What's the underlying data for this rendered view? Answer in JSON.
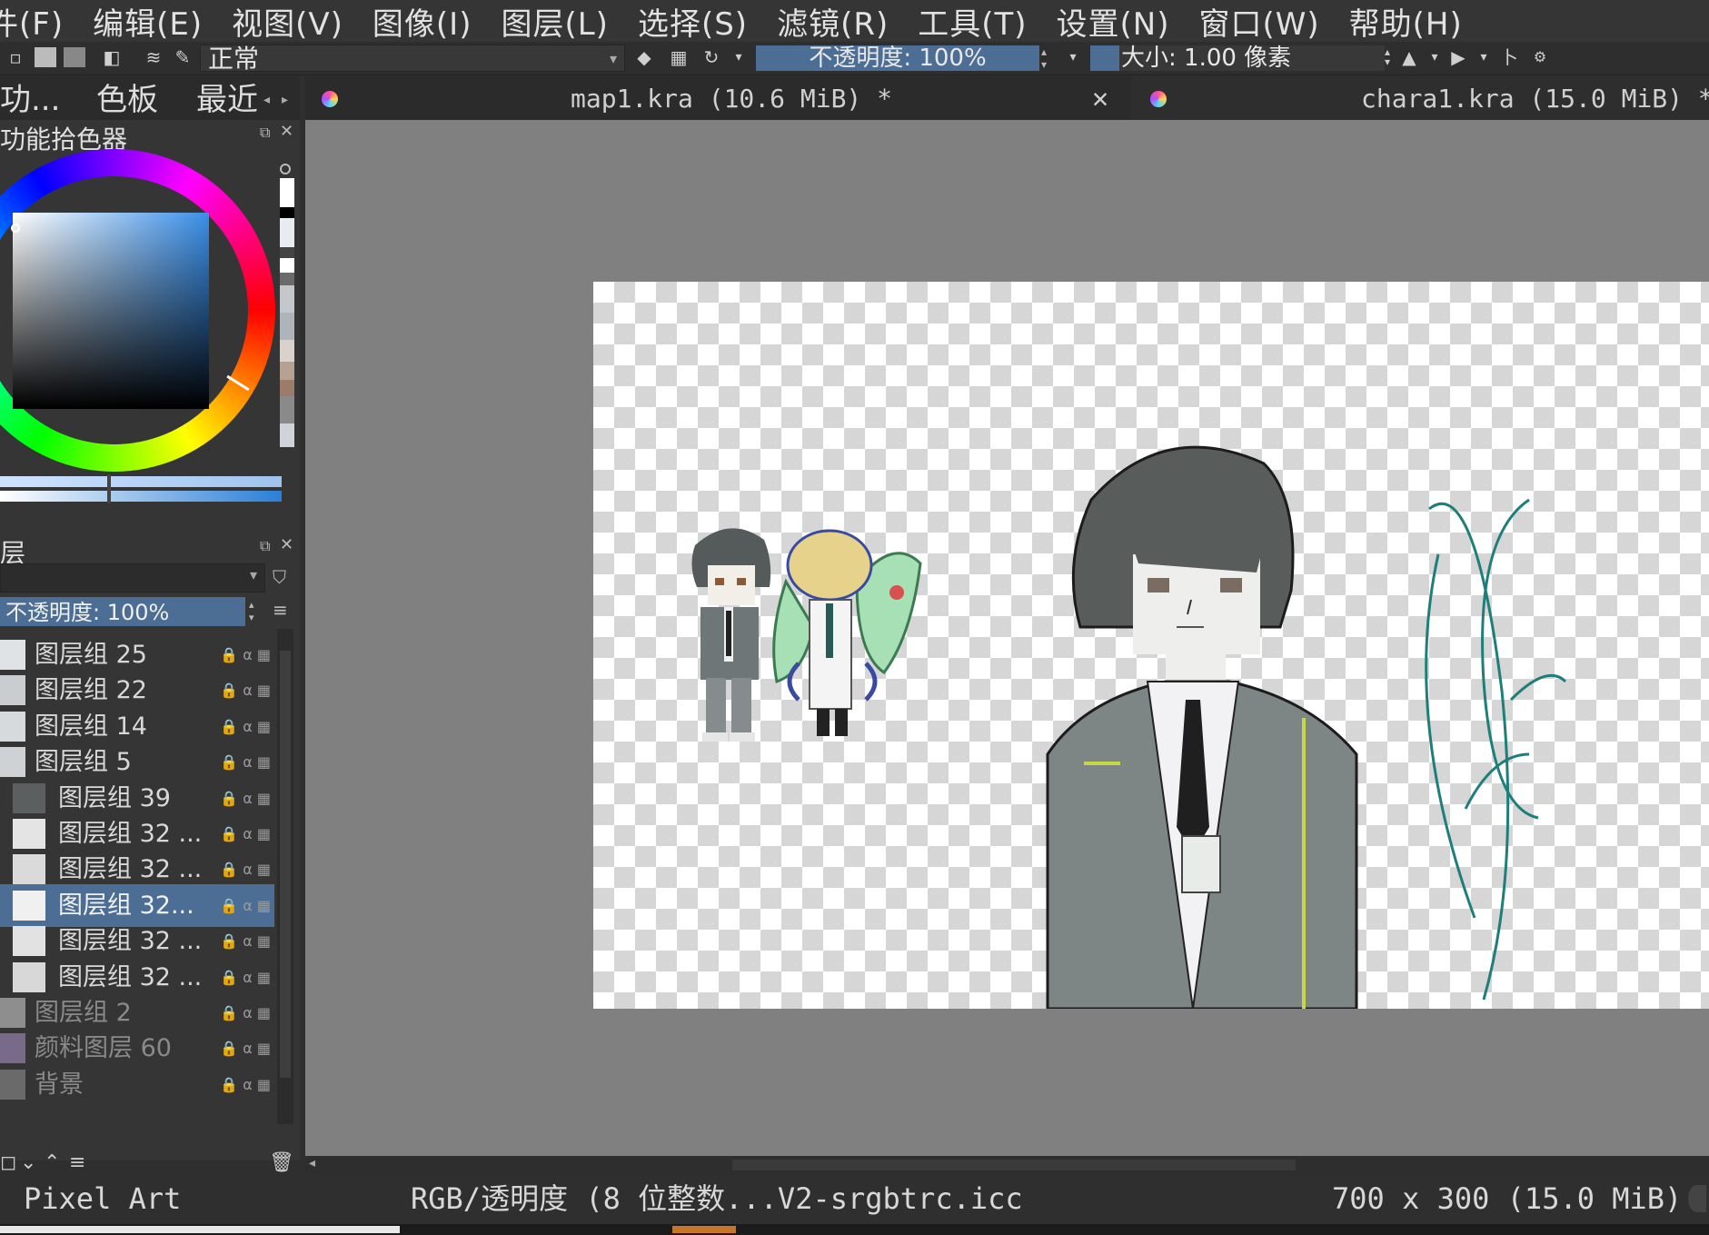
{
  "menu": [
    "件(F)",
    "编辑(E)",
    "视图(V)",
    "图像(I)",
    "图层(L)",
    "选择(S)",
    "滤镜(R)",
    "工具(T)",
    "设置(N)",
    "窗口(W)",
    "帮助(H)"
  ],
  "toolbar": {
    "blend_mode": "正常",
    "opacity_label": "不透明度:  100%",
    "size_label": "大小:  1.00 像素"
  },
  "dock_tabs": [
    "功...",
    "色板",
    "最近"
  ],
  "color_panel": {
    "title": "功能拾色器"
  },
  "layers_panel": {
    "title": "层",
    "opacity_label": "不透明度:  100%",
    "layers": [
      {
        "name": "图层组 25",
        "indent": 0,
        "selected": false,
        "dim": false
      },
      {
        "name": "图层组 22",
        "indent": 0,
        "selected": false,
        "dim": false
      },
      {
        "name": "图层组 14",
        "indent": 0,
        "selected": false,
        "dim": false
      },
      {
        "name": "图层组 5",
        "indent": 0,
        "selected": false,
        "dim": false
      },
      {
        "name": "图层组 39",
        "indent": 1,
        "selected": false,
        "dim": false
      },
      {
        "name": "图层组 32 ...",
        "indent": 1,
        "selected": false,
        "dim": false
      },
      {
        "name": "图层组 32 ...",
        "indent": 1,
        "selected": false,
        "dim": false
      },
      {
        "name": "图层组 32...",
        "indent": 1,
        "selected": true,
        "dim": false
      },
      {
        "name": "图层组 32 ...",
        "indent": 1,
        "selected": false,
        "dim": false
      },
      {
        "name": "图层组 32 ...",
        "indent": 1,
        "selected": false,
        "dim": false
      },
      {
        "name": "图层组 2",
        "indent": 0,
        "selected": false,
        "dim": true
      },
      {
        "name": "颜料图层 60",
        "indent": 0,
        "selected": false,
        "dim": true
      },
      {
        "name": "背景",
        "indent": 0,
        "selected": false,
        "dim": true
      }
    ]
  },
  "documents": [
    {
      "title": "map1.kra (10.6 MiB) *",
      "active": false
    },
    {
      "title": "chara1.kra (15.0 MiB) *",
      "active": true
    }
  ],
  "status": {
    "brush_preset": "Pixel Art",
    "color_space": "RGB/透明度 (8 位整数...V2-srgbtrc.icc",
    "dimensions": "700 x 300 (15.0 MiB)"
  },
  "colors": {
    "accent": "#4c6e95",
    "canvas_bg": "#808080"
  }
}
